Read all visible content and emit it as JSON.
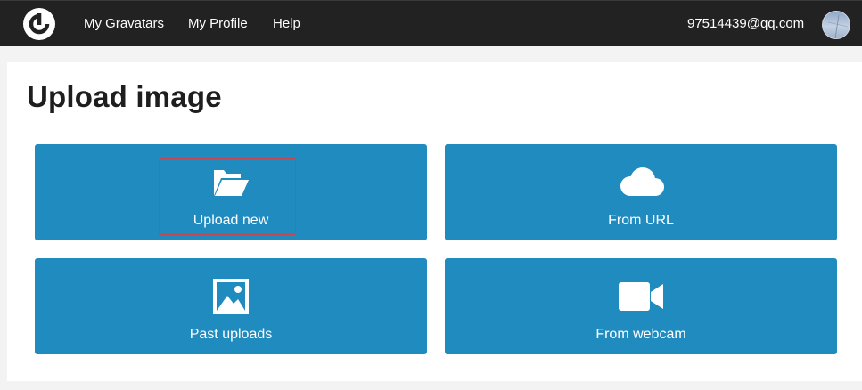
{
  "header": {
    "nav": [
      {
        "label": "My Gravatars"
      },
      {
        "label": "My Profile"
      },
      {
        "label": "Help"
      }
    ],
    "user_email": "97514439@qq.com"
  },
  "main": {
    "title": "Upload image",
    "options": [
      {
        "label": "Upload new",
        "icon": "folder-open-icon"
      },
      {
        "label": "From URL",
        "icon": "cloud-icon"
      },
      {
        "label": "Past uploads",
        "icon": "image-icon"
      },
      {
        "label": "From webcam",
        "icon": "video-camera-icon"
      }
    ]
  },
  "colors": {
    "topbar": "#222222",
    "tile": "#1f8bbf",
    "focus_outline": "#c9444e"
  }
}
